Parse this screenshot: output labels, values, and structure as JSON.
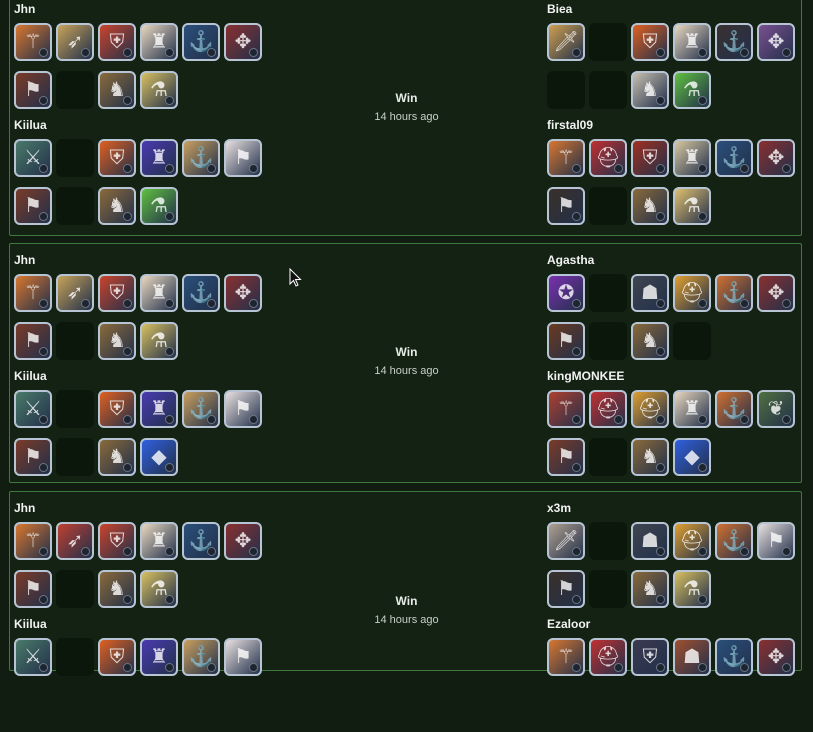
{
  "colors": {
    "background": "#121d12",
    "card_border": "#3e7a3e",
    "slot_border": "#b6c4d4",
    "text": "#f2f2f2"
  },
  "matches": [
    {
      "result": "Win",
      "time": "14 hours ago",
      "left": [
        {
          "name": "Jhn",
          "row1": [
            {
              "icon": "staff-icon",
              "tint": "#d8772f"
            },
            {
              "icon": "bow-icon",
              "tint": "#c7a35a"
            },
            {
              "icon": "armor-icon",
              "tint": "#c9442c"
            },
            {
              "icon": "robe-icon",
              "tint": "#e8d8c0"
            },
            {
              "icon": "boots-icon",
              "tint": "#2a4f7a"
            },
            {
              "icon": "crossbow-icon",
              "tint": "#8a3030"
            }
          ],
          "row2": [
            {
              "icon": "cape-icon",
              "tint": "#7a3b28"
            },
            {
              "icon": "empty",
              "tint": ""
            },
            {
              "icon": "mount-icon",
              "tint": "#8a6a3a"
            },
            {
              "icon": "potion-icon",
              "tint": "#d8c060"
            }
          ]
        },
        {
          "name": "Kiilua",
          "row1": [
            {
              "icon": "weapon-icon",
              "tint": "#4a7a6a"
            },
            {
              "icon": "empty",
              "tint": ""
            },
            {
              "icon": "armor-icon",
              "tint": "#e06020"
            },
            {
              "icon": "robe-icon",
              "tint": "#4a3ab0"
            },
            {
              "icon": "boots-icon",
              "tint": "#c9a060"
            },
            {
              "icon": "cape-icon",
              "tint": "#e8e0e0"
            }
          ],
          "row2": [
            {
              "icon": "cape-icon",
              "tint": "#7a3b28"
            },
            {
              "icon": "empty",
              "tint": ""
            },
            {
              "icon": "mount-icon",
              "tint": "#8a6a3a"
            },
            {
              "icon": "potion-icon",
              "tint": "#60c040"
            }
          ]
        }
      ],
      "right": [
        {
          "name": "Biea",
          "row1": [
            {
              "icon": "sword-icon",
              "tint": "#d0a050"
            },
            {
              "icon": "empty",
              "tint": ""
            },
            {
              "icon": "armor-icon",
              "tint": "#e06020"
            },
            {
              "icon": "robe-icon",
              "tint": "#e8d8c0"
            },
            {
              "icon": "boots-icon",
              "tint": "#3a3030"
            },
            {
              "icon": "crossbow-icon",
              "tint": "#7a5090"
            }
          ],
          "row2": [
            {
              "icon": "empty",
              "tint": ""
            },
            {
              "icon": "empty",
              "tint": ""
            },
            {
              "icon": "mount-icon",
              "tint": "#c8c0b0"
            },
            {
              "icon": "potion-icon",
              "tint": "#60c040"
            }
          ]
        },
        {
          "name": "firstal09",
          "row1": [
            {
              "icon": "staff-icon",
              "tint": "#d8772f"
            },
            {
              "icon": "helmet-icon",
              "tint": "#c03030"
            },
            {
              "icon": "armor-icon",
              "tint": "#a03020"
            },
            {
              "icon": "robe-icon",
              "tint": "#d8c8a0"
            },
            {
              "icon": "boots-icon",
              "tint": "#2a4f7a"
            },
            {
              "icon": "crossbow-icon",
              "tint": "#8a3030"
            }
          ],
          "row2": [
            {
              "icon": "cape-icon",
              "tint": "#3a3028"
            },
            {
              "icon": "empty",
              "tint": ""
            },
            {
              "icon": "mount-icon",
              "tint": "#8a6a3a"
            },
            {
              "icon": "potion-icon",
              "tint": "#e0c070"
            }
          ]
        }
      ]
    },
    {
      "result": "Win",
      "time": "14 hours ago",
      "left": [
        {
          "name": "Jhn",
          "row1": [
            {
              "icon": "staff-icon",
              "tint": "#d8772f"
            },
            {
              "icon": "bow-icon",
              "tint": "#c7a35a"
            },
            {
              "icon": "armor-icon",
              "tint": "#c9442c"
            },
            {
              "icon": "robe-icon",
              "tint": "#e8d8c0"
            },
            {
              "icon": "boots-icon",
              "tint": "#2a4f7a"
            },
            {
              "icon": "crossbow-icon",
              "tint": "#8a3030"
            }
          ],
          "row2": [
            {
              "icon": "cape-icon",
              "tint": "#7a3b28"
            },
            {
              "icon": "empty",
              "tint": ""
            },
            {
              "icon": "mount-icon",
              "tint": "#8a6a3a"
            },
            {
              "icon": "potion-icon",
              "tint": "#d8c060"
            }
          ]
        },
        {
          "name": "Kiilua",
          "row1": [
            {
              "icon": "weapon-icon",
              "tint": "#4a7a6a"
            },
            {
              "icon": "empty",
              "tint": ""
            },
            {
              "icon": "armor-icon",
              "tint": "#e06020"
            },
            {
              "icon": "robe-icon",
              "tint": "#4a3ab0"
            },
            {
              "icon": "boots-icon",
              "tint": "#c9a060"
            },
            {
              "icon": "cape-icon",
              "tint": "#e8e0e0"
            }
          ],
          "row2": [
            {
              "icon": "cape-icon",
              "tint": "#7a3b28"
            },
            {
              "icon": "empty",
              "tint": ""
            },
            {
              "icon": "mount-icon",
              "tint": "#8a6a3a"
            },
            {
              "icon": "gem-icon",
              "tint": "#3060e0"
            }
          ]
        }
      ],
      "right": [
        {
          "name": "Agastha",
          "row1": [
            {
              "icon": "orb-icon",
              "tint": "#7a30b0"
            },
            {
              "icon": "empty",
              "tint": ""
            },
            {
              "icon": "hood-icon",
              "tint": "#404550"
            },
            {
              "icon": "helmet-icon",
              "tint": "#e0a030"
            },
            {
              "icon": "boots-icon",
              "tint": "#d07030"
            },
            {
              "icon": "crossbow-icon",
              "tint": "#8a3030"
            }
          ],
          "row2": [
            {
              "icon": "cape-icon",
              "tint": "#6a3a20"
            },
            {
              "icon": "empty",
              "tint": ""
            },
            {
              "icon": "mount-icon",
              "tint": "#8a6a3a"
            },
            {
              "icon": "empty",
              "tint": ""
            }
          ]
        },
        {
          "name": "kingMONKEE",
          "row1": [
            {
              "icon": "staff-icon",
              "tint": "#b04030"
            },
            {
              "icon": "helmet-icon",
              "tint": "#c03030"
            },
            {
              "icon": "helmet-icon",
              "tint": "#e0a030"
            },
            {
              "icon": "robe-icon",
              "tint": "#e8d8c0"
            },
            {
              "icon": "boots-icon",
              "tint": "#d07030"
            },
            {
              "icon": "leaf-icon",
              "tint": "#507040"
            }
          ],
          "row2": [
            {
              "icon": "cape-icon",
              "tint": "#7a3b28"
            },
            {
              "icon": "empty",
              "tint": ""
            },
            {
              "icon": "mount-icon",
              "tint": "#8a6a3a"
            },
            {
              "icon": "gem-icon",
              "tint": "#3060e0"
            }
          ]
        }
      ]
    },
    {
      "result": "Win",
      "time": "14 hours ago",
      "left": [
        {
          "name": "Jhn",
          "row1": [
            {
              "icon": "staff-icon",
              "tint": "#d8772f"
            },
            {
              "icon": "bow-icon",
              "tint": "#c04030"
            },
            {
              "icon": "armor-icon",
              "tint": "#c9442c"
            },
            {
              "icon": "robe-icon",
              "tint": "#e8d8c0"
            },
            {
              "icon": "boots-icon",
              "tint": "#2a4f7a"
            },
            {
              "icon": "crossbow-icon",
              "tint": "#8a3030"
            }
          ],
          "row2": [
            {
              "icon": "cape-icon",
              "tint": "#7a3b28"
            },
            {
              "icon": "empty",
              "tint": ""
            },
            {
              "icon": "mount-icon",
              "tint": "#8a6a3a"
            },
            {
              "icon": "potion-icon",
              "tint": "#d8c060"
            }
          ]
        },
        {
          "name": "Kiilua",
          "row1": [
            {
              "icon": "weapon-icon",
              "tint": "#4a7a6a"
            },
            {
              "icon": "empty",
              "tint": ""
            },
            {
              "icon": "armor-icon",
              "tint": "#e06020"
            },
            {
              "icon": "robe-icon",
              "tint": "#4a3ab0"
            },
            {
              "icon": "boots-icon",
              "tint": "#c9a060"
            },
            {
              "icon": "cape-icon",
              "tint": "#e8e0e0"
            }
          ],
          "row2": []
        }
      ],
      "right": [
        {
          "name": "x3m",
          "row1": [
            {
              "icon": "sword-icon",
              "tint": "#b0a090"
            },
            {
              "icon": "empty",
              "tint": ""
            },
            {
              "icon": "hood-icon",
              "tint": "#404550"
            },
            {
              "icon": "helmet-icon",
              "tint": "#e0a030"
            },
            {
              "icon": "boots-icon",
              "tint": "#d07030"
            },
            {
              "icon": "cape-icon",
              "tint": "#e8e0e0"
            }
          ],
          "row2": [
            {
              "icon": "cape-icon",
              "tint": "#3a3028"
            },
            {
              "icon": "empty",
              "tint": ""
            },
            {
              "icon": "mount-icon",
              "tint": "#8a6a3a"
            },
            {
              "icon": "potion-icon",
              "tint": "#d8c060"
            }
          ]
        },
        {
          "name": "Ezaloor",
          "row1": [
            {
              "icon": "staff-icon",
              "tint": "#d8772f"
            },
            {
              "icon": "helmet-icon",
              "tint": "#c03030"
            },
            {
              "icon": "armor-icon",
              "tint": "#3a3a50"
            },
            {
              "icon": "hood-icon",
              "tint": "#a05030"
            },
            {
              "icon": "boots-icon",
              "tint": "#2a4f7a"
            },
            {
              "icon": "crossbow-icon",
              "tint": "#8a3030"
            }
          ],
          "row2": []
        }
      ]
    }
  ]
}
